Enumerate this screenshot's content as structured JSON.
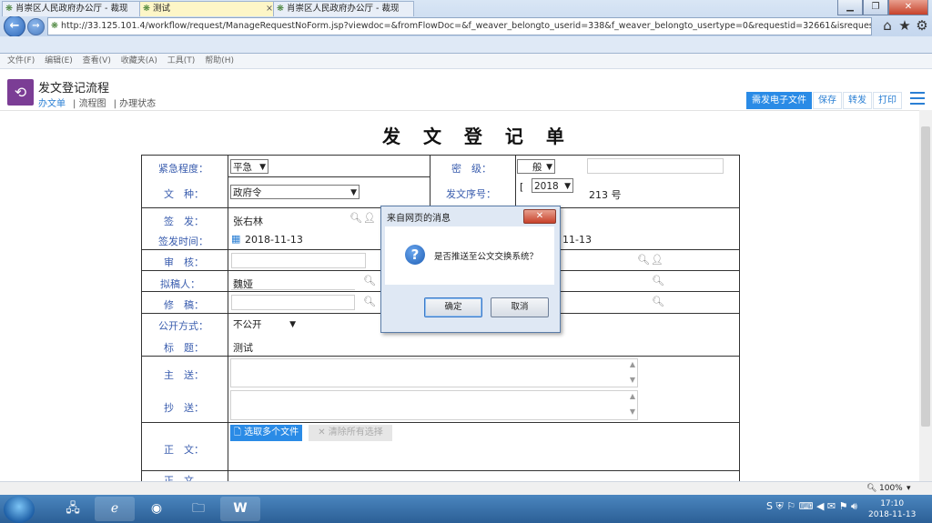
{
  "browser": {
    "url": "http://33.125.101.4/workflow/request/ManageRequestNoForm.jsp?viewdoc=&fromFlowDoc=&f_weaver_belongto_userid=338&f_weaver_belongto_usertype=0&requestid=32661&isrequest=0&isovertime=0",
    "back_label": "←",
    "forward_label": "→",
    "home_label": "⌂",
    "fav_label": "★",
    "settings_label": "⚙",
    "win_min": "▁",
    "win_restore": "❐",
    "win_close": "✕",
    "tabs": [
      {
        "label": "肖崇区人民政府办公厅 - 裁现",
        "active": false
      },
      {
        "label": "测试",
        "active": true
      },
      {
        "label": "肖崇区人民政府办公厅 - 裁现",
        "active": false
      }
    ],
    "tab_close": "×",
    "menu": [
      "文件(F)",
      "编辑(E)",
      "查看(V)",
      "收藏夹(A)",
      "工具(T)",
      "帮助(H)"
    ]
  },
  "app": {
    "icon_label": "⟲",
    "title": "发文登记流程",
    "nav": [
      {
        "label": "办文单",
        "active": true
      },
      {
        "label": "流程图",
        "active": false
      },
      {
        "label": "办理状态",
        "active": false
      }
    ],
    "buttons": {
      "send": "需发电子文件",
      "save": "保存",
      "forward": "转发",
      "print": "打印"
    }
  },
  "form": {
    "title": "发 文 登 记 单",
    "urgency": {
      "label": "紧急程度：",
      "value": "平急"
    },
    "level": {
      "label": "密　级：",
      "value": "般"
    },
    "doctype": {
      "label": "文　种：",
      "value": "政府令"
    },
    "serial": {
      "label": "发文序号：",
      "bracket": "[",
      "year": "2018",
      "no": "213 号"
    },
    "signer": {
      "label": "签　发：",
      "value": "张右林"
    },
    "sign_time": {
      "label": "签发时间：",
      "value": "2018-11-13"
    },
    "right_date": "11-13",
    "review": {
      "label": "审　核："
    },
    "drafter": {
      "label": "拟稿人：",
      "value": "魏娅"
    },
    "editor": {
      "label": "修　稿："
    },
    "publish": {
      "label": "公开方式：",
      "value": "不公开"
    },
    "subject": {
      "label": "标　题：",
      "value": "测试"
    },
    "main_to": {
      "label": "主　送："
    },
    "cc": {
      "label": "抄　送："
    },
    "body": {
      "label": "正　文："
    },
    "upload_btn": "选取多个文件",
    "clear_btn": "清除所有选择",
    "next_label": "正　文"
  },
  "dialog": {
    "title": "来自网页的消息",
    "close": "✕",
    "icon": "?",
    "message": "是否推送至公文交换系统？",
    "ok": "确定",
    "cancel": "取消"
  },
  "status": {
    "zoom": "100%"
  },
  "taskbar": {
    "time": "17:10",
    "date": "2018-11-13"
  }
}
